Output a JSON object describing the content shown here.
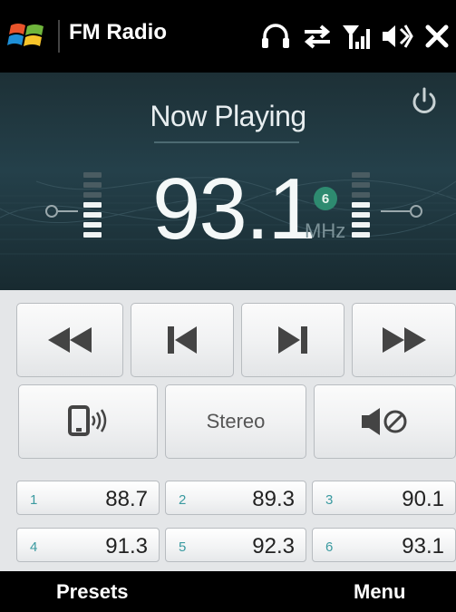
{
  "statusbar": {
    "title": "FM Radio",
    "icons": [
      "windows-start-icon",
      "headphones-icon",
      "data-transfer-icon",
      "signal-strength-icon",
      "volume-icon",
      "close-icon"
    ]
  },
  "display": {
    "heading": "Now Playing",
    "frequency": "93.1",
    "preset_number": "6",
    "unit": "MHz",
    "power_icon": "power-icon"
  },
  "transport": {
    "buttons": [
      "rewind-icon",
      "previous-icon",
      "next-icon",
      "fast-forward-icon"
    ]
  },
  "options": {
    "speaker_icon": "speaker-phone-icon",
    "stereo_label": "Stereo",
    "mute_icon": "mute-icon"
  },
  "presets": [
    {
      "num": "1",
      "freq": "88.7"
    },
    {
      "num": "2",
      "freq": "89.3"
    },
    {
      "num": "3",
      "freq": "90.1"
    },
    {
      "num": "4",
      "freq": "91.3"
    },
    {
      "num": "5",
      "freq": "92.3"
    },
    {
      "num": "6",
      "freq": "93.1"
    }
  ],
  "softkeys": {
    "left": "Presets",
    "right": "Menu"
  },
  "colors": {
    "display_bg": "#24404a",
    "preset_badge": "#2e8b70",
    "preset_number": "#3a9aa0"
  }
}
